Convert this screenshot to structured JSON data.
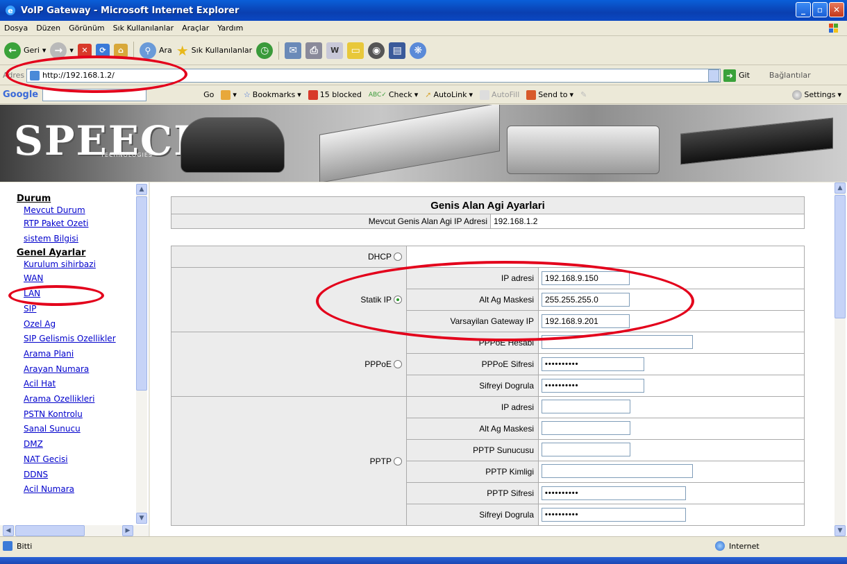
{
  "window": {
    "title": "VoIP Gateway - Microsoft Internet Explorer"
  },
  "menu": [
    "Dosya",
    "Düzen",
    "Görünüm",
    "Sık Kullanılanlar",
    "Araçlar",
    "Yardım"
  ],
  "toolbar": {
    "back": "Geri",
    "search": "Ara",
    "favorites": "Sık Kullanılanlar"
  },
  "address": {
    "label": "Adres",
    "url": "http://192.168.1.2/",
    "go": "Git",
    "links": "Bağlantılar"
  },
  "googlebar": {
    "logo": "Google",
    "go": "Go",
    "bookmarks": "Bookmarks",
    "blocked": "15 blocked",
    "check": "Check",
    "autolink": "AutoLink",
    "autofill": "AutoFill",
    "sendto": "Send to",
    "settings": "Settings"
  },
  "banner": {
    "logo": "SPEECH",
    "sub": "TECHNOLOGIES"
  },
  "nav": {
    "durum_head": "Durum",
    "durum_items": [
      "Mevcut Durum",
      "RTP Paket Ozeti",
      "sistem Bilgisi"
    ],
    "genel_head": "Genel Ayarlar",
    "genel_items": [
      "Kurulum sihirbazi",
      "WAN",
      "LAN",
      "SIP",
      "Ozel Ag",
      "SIP Gelismis Ozellikler",
      "Arama Plani",
      "Arayan Numara",
      "Acil Hat",
      "Arama Ozellikleri",
      "PSTN Kontrolu",
      "Sanal Sunucu",
      "DMZ",
      "NAT Gecisi",
      "DDNS",
      "Acil Numara"
    ]
  },
  "main": {
    "title": "Genis Alan Agi Ayarlari",
    "current_ip_label": "Mevcut Genis Alan Agi IP Adresi",
    "current_ip_value": "192.168.1.2",
    "dhcp_label": "DHCP",
    "static_label": "Statik IP",
    "static": {
      "ip_label": "IP adresi",
      "ip_value": "192.168.9.150",
      "mask_label": "Alt Ag Maskesi",
      "mask_value": "255.255.255.0",
      "gw_label": "Varsayilan Gateway IP",
      "gw_value": "192.168.9.201"
    },
    "pppoe_label": "PPPoE",
    "pppoe": {
      "account_label": "PPPoE Hesabi",
      "account_value": "",
      "pass_label": "PPPoE Sifresi",
      "pass_value": "••••••••••",
      "verify_label": "Sifreyi Dogrula",
      "verify_value": "••••••••••"
    },
    "pptp_label": "PPTP",
    "pptp": {
      "ip_label": "IP adresi",
      "mask_label": "Alt Ag Maskesi",
      "server_label": "PPTP Sunucusu",
      "id_label": "PPTP Kimligi",
      "pass_label": "PPTP Sifresi",
      "pass_value": "••••••••••",
      "verify_label": "Sifreyi Dogrula",
      "verify_value": "••••••••••"
    }
  },
  "status": {
    "left": "Bitti",
    "zone": "Internet"
  },
  "annotation_color": "#e3001b"
}
